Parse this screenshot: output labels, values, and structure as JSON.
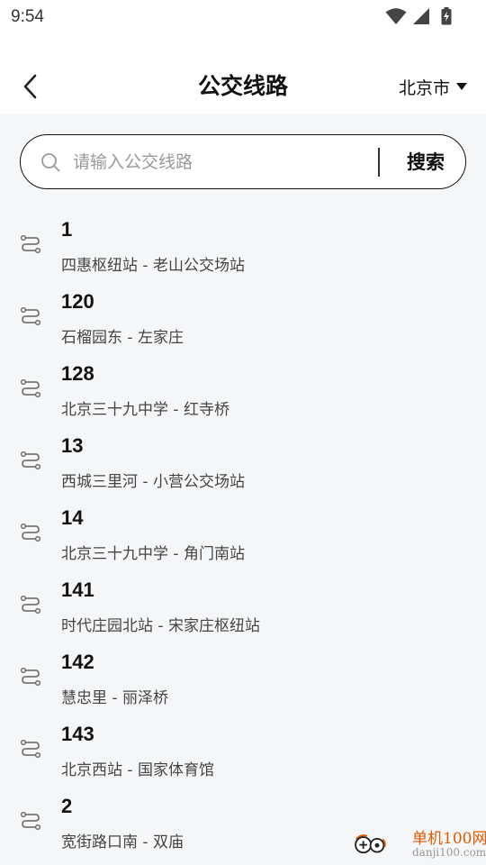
{
  "status_bar": {
    "time": "9:54",
    "icons": [
      "wifi-icon",
      "signal-icon",
      "battery-charging-icon"
    ]
  },
  "header": {
    "back_icon": "chevron-left-icon",
    "title": "公交线路",
    "city": "北京市",
    "city_dropdown_icon": "caret-down-icon"
  },
  "search": {
    "icon": "search-icon",
    "placeholder": "请输入公交线路",
    "value": "",
    "button_label": "搜索"
  },
  "routes": [
    {
      "number": "1",
      "stops": "四惠枢纽站 - 老山公交场站"
    },
    {
      "number": "120",
      "stops": "石榴园东 - 左家庄"
    },
    {
      "number": "128",
      "stops": "北京三十九中学 - 红寺桥"
    },
    {
      "number": "13",
      "stops": "西城三里河 - 小营公交场站"
    },
    {
      "number": "14",
      "stops": "北京三十九中学 - 角门南站"
    },
    {
      "number": "141",
      "stops": "时代庄园北站 - 宋家庄枢纽站"
    },
    {
      "number": "142",
      "stops": "慧忠里 - 丽泽桥"
    },
    {
      "number": "143",
      "stops": "北京西站 - 国家体育馆"
    },
    {
      "number": "2",
      "stops": "宽街路口南 - 双庙"
    }
  ],
  "route_icon": "route-icon",
  "watermark": {
    "text_cn": "单机100网",
    "text_en": "danji100.com"
  },
  "colors": {
    "background": "#f5f6f8",
    "header_bg": "#ffffff",
    "text_primary": "#111111",
    "text_secondary": "#444444",
    "placeholder": "#9a9a9a",
    "watermark_orange": "#e05a00"
  }
}
